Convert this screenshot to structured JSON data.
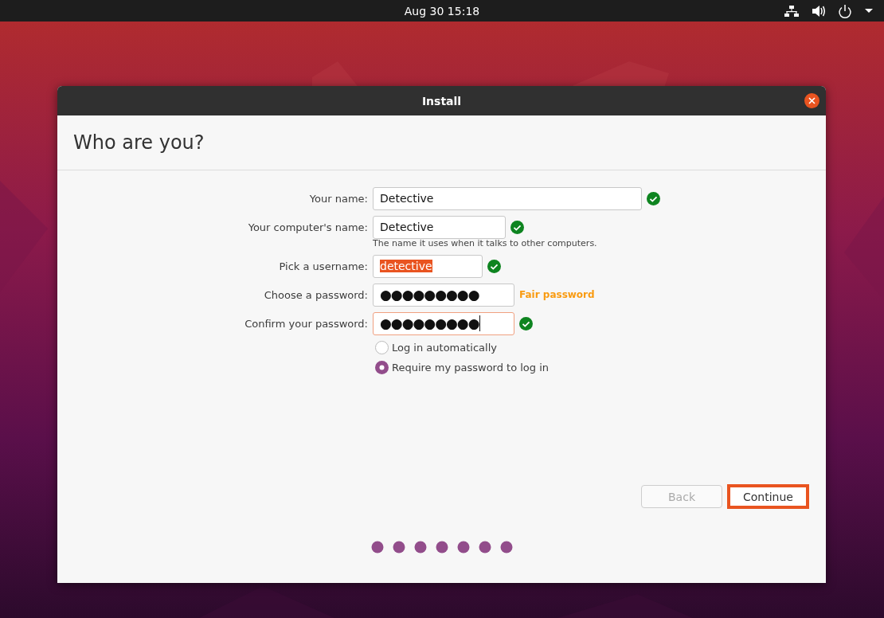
{
  "top_bar": {
    "clock": "Aug 30  15:18"
  },
  "window": {
    "title": "Install",
    "heading": "Who are you?"
  },
  "fields": [
    {
      "label": "Your name:",
      "value": "Detective",
      "kind": "text",
      "selected": false,
      "focused": false,
      "status": {
        "kind": "check"
      }
    },
    {
      "label": "Your computer's name:",
      "value": "Detective",
      "kind": "text",
      "selected": false,
      "focused": false,
      "status": {
        "kind": "check"
      },
      "hint": "The name it uses when it talks to other computers."
    },
    {
      "label": "Pick a username:",
      "value": "detective",
      "kind": "text",
      "selected": true,
      "focused": false,
      "status": {
        "kind": "check"
      }
    },
    {
      "label": "Choose a password:",
      "value": "●●●●●●●●●",
      "kind": "password",
      "selected": false,
      "focused": false,
      "status": {
        "kind": "strength",
        "text": "Fair password"
      }
    },
    {
      "label": "Confirm your password:",
      "value": "●●●●●●●●●",
      "kind": "password",
      "selected": false,
      "focused": true,
      "status": {
        "kind": "check"
      }
    }
  ],
  "login_options": [
    {
      "label": "Log in automatically",
      "selected": false
    },
    {
      "label": "Require my password to log in",
      "selected": true
    }
  ],
  "buttons": [
    {
      "label": "Back",
      "disabled": true,
      "focused": false
    },
    {
      "label": "Continue",
      "disabled": false,
      "focused": true
    }
  ]
}
